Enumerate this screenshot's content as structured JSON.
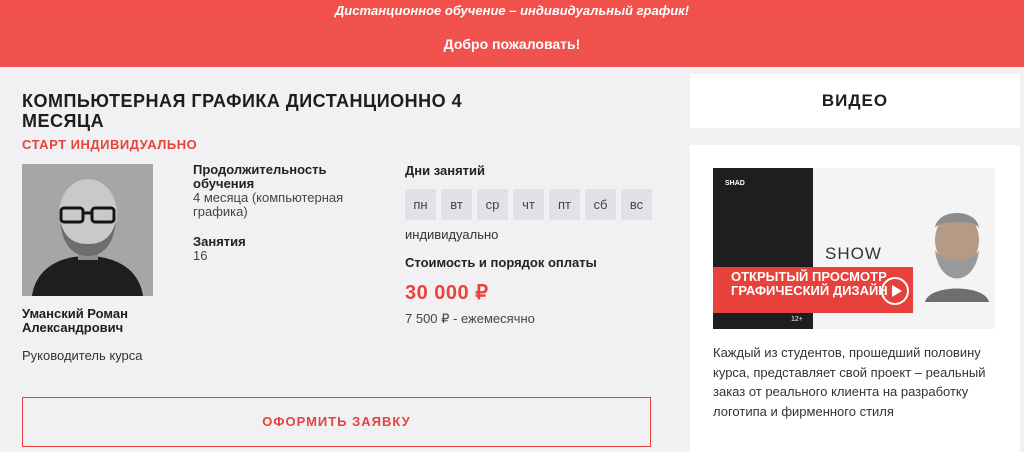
{
  "header": {
    "top_strip": "Дистанционное обучение – индивидуальный график!",
    "welcome": "Добро пожаловать!"
  },
  "course": {
    "title": "КОМПЬЮТЕРНАЯ ГРАФИКА ДИСТАНЦИОННО 4 МЕСЯЦА",
    "start": "СТАРТ ИНДИВИДУАЛЬНО",
    "teacher": {
      "name": "Уманский Роман Александрович",
      "role": "Руководитель курса"
    },
    "duration_label": "Продолжительность обучения",
    "duration_value": "4 месяца (компьютерная графика)",
    "lessons_label": "Занятия",
    "lessons_value": "16",
    "days_label": "Дни занятий",
    "days": [
      "пн",
      "вт",
      "ср",
      "чт",
      "пт",
      "сб",
      "вс"
    ],
    "schedule_type": "индивидуально",
    "price_label": "Стоимость и порядок оплаты",
    "price": "30 000 ₽",
    "price_monthly": "7 500 ₽ - ежемесячно",
    "apply_button": "ОФОРМИТЬ ЗАЯВКУ"
  },
  "video": {
    "heading": "ВИДЕО",
    "thumb_logo": "SHAD",
    "thumb_show": "SHOW",
    "thumb_banner": "ОТКРЫТЫЙ ПРОСМОТР ГРАФИЧЕСКИЙ ДИЗАЙН",
    "thumb_age": "12+",
    "description": "Каждый из студентов, прошедший половину курса, представляет свой проект – реальный заказ от реального клиента на разработку логотипа и фирменного стиля"
  },
  "colors": {
    "accent": "#e8423d",
    "header_bg": "#f0524d",
    "panel_bg": "#f1f1f3",
    "chip_bg": "#e2e2e6"
  }
}
